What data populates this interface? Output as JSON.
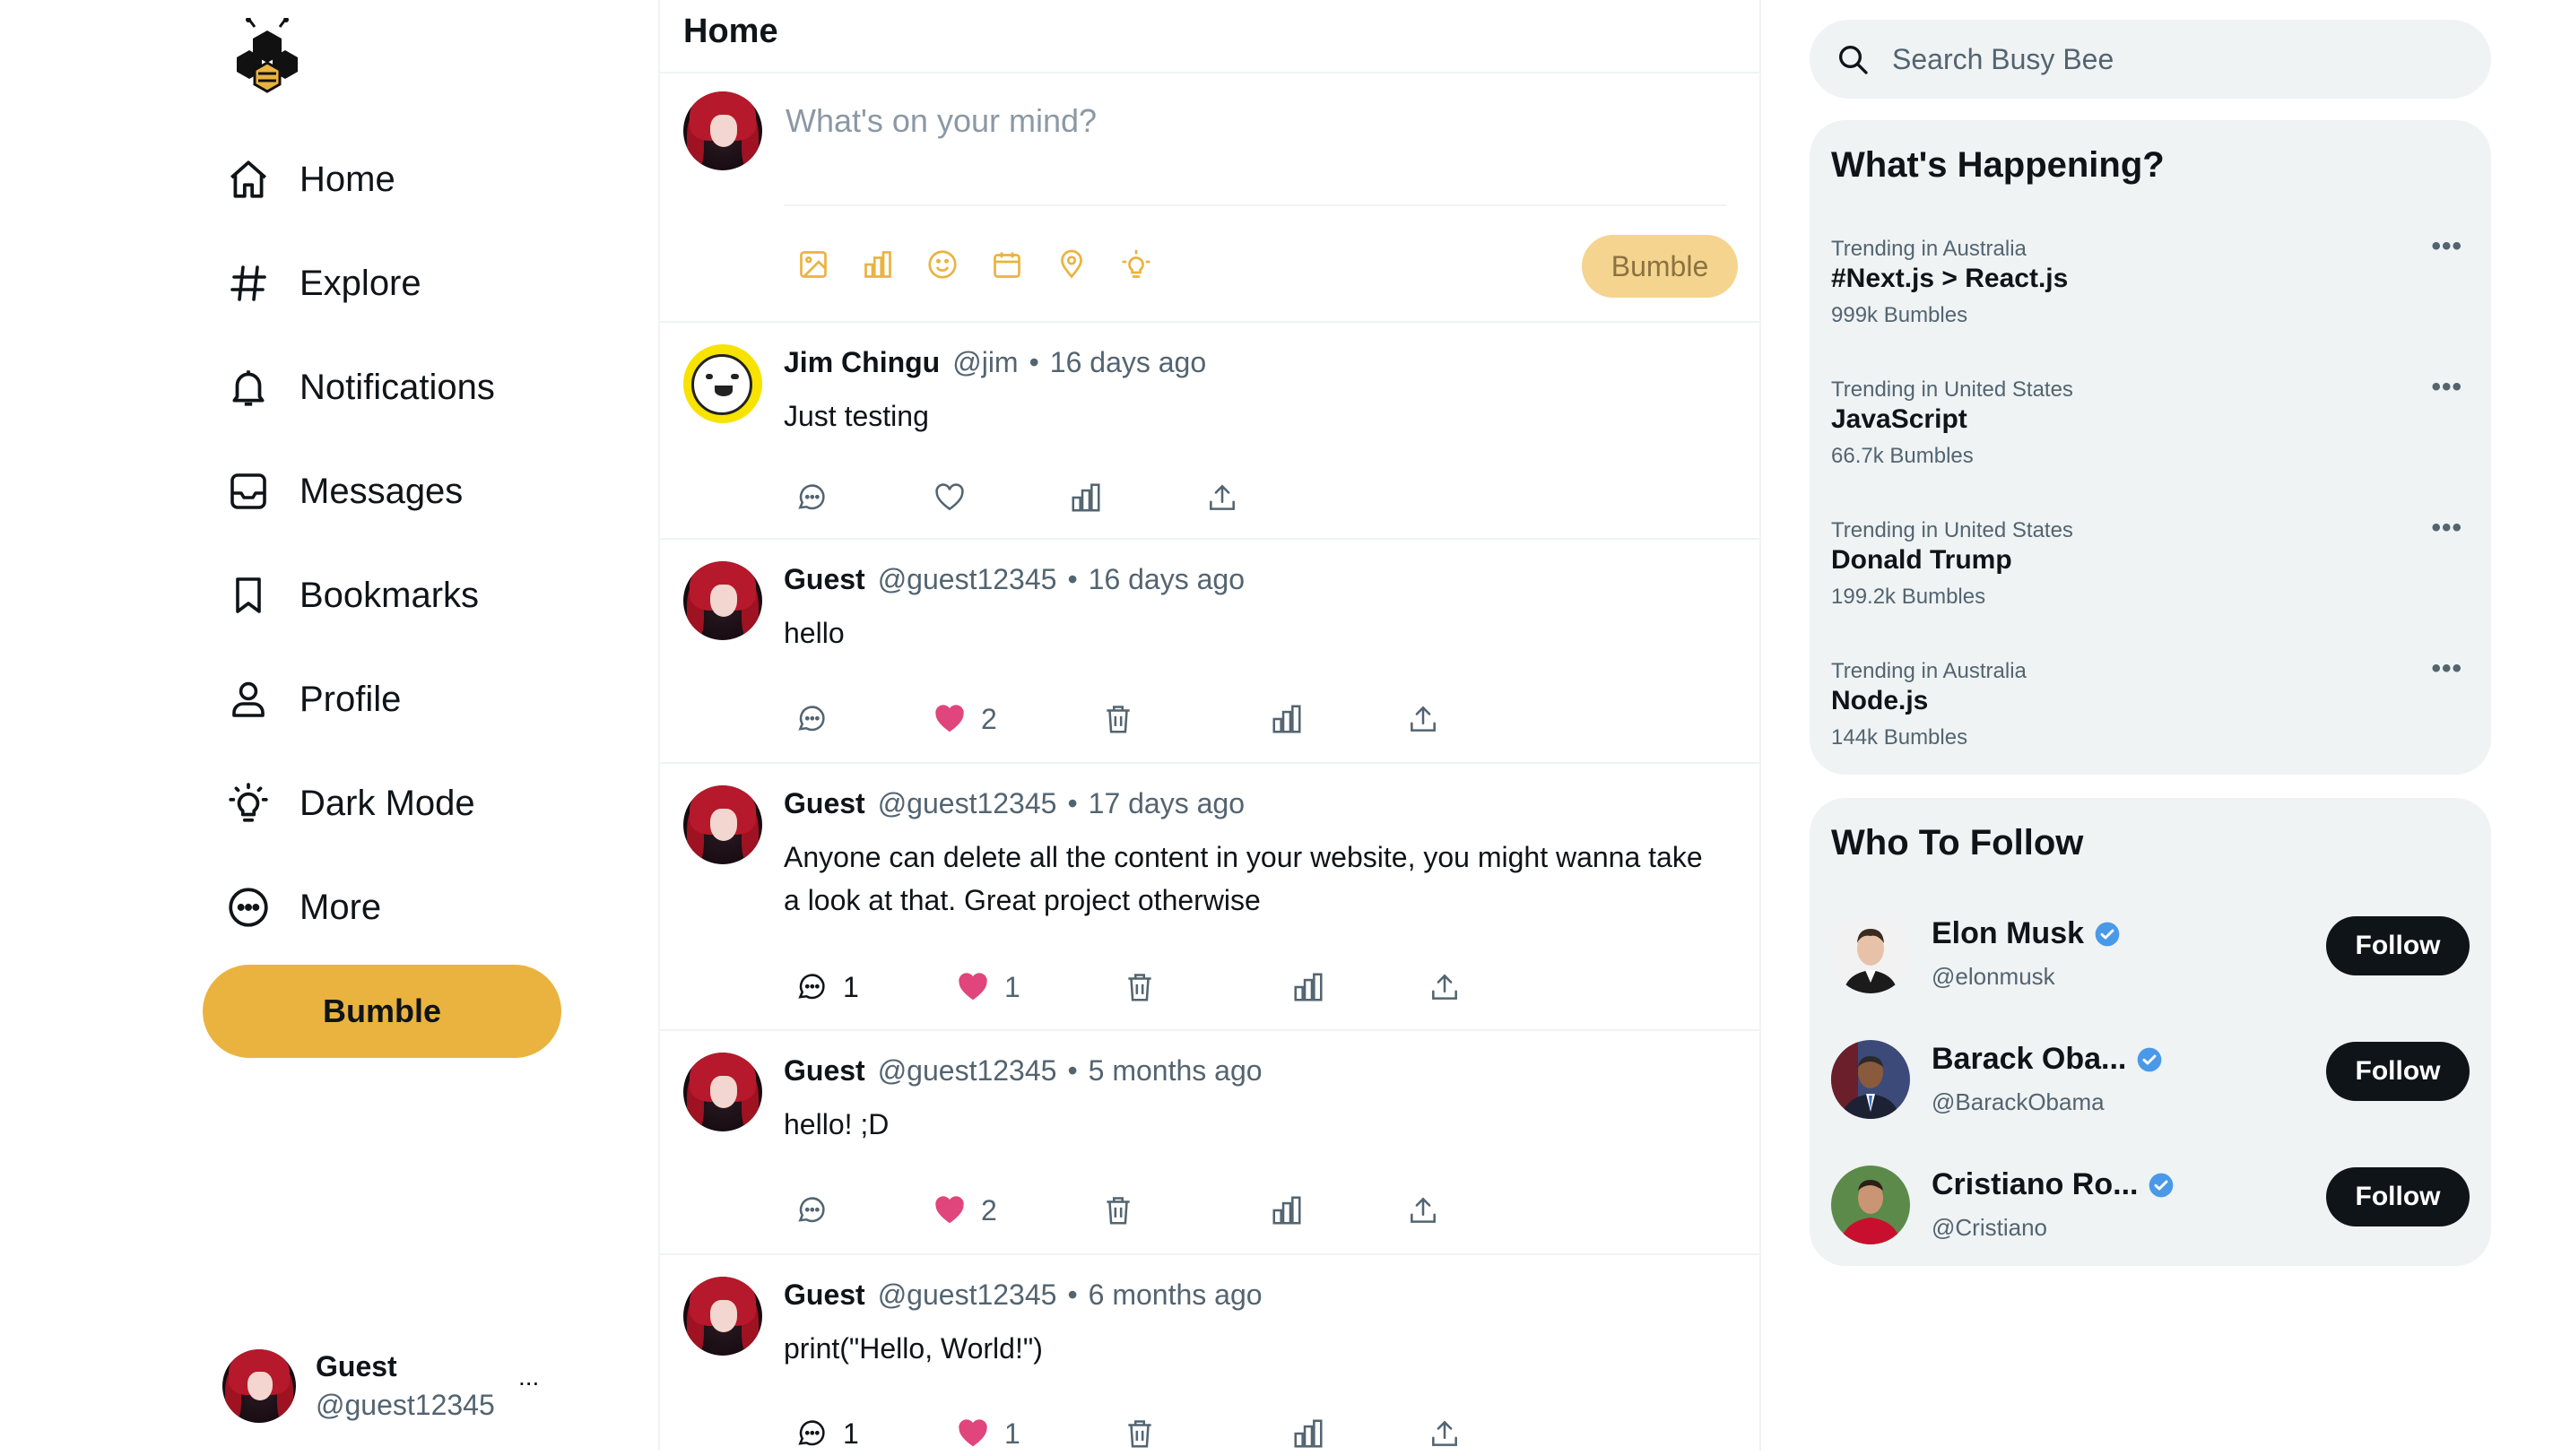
{
  "app": {
    "name": "Busy Bee",
    "accent_color": "#eab33f",
    "logo_icon": "bee-hexagon-logo"
  },
  "nav": {
    "items": [
      {
        "label": "Home",
        "icon": "home-icon"
      },
      {
        "label": "Explore",
        "icon": "hashtag-icon"
      },
      {
        "label": "Notifications",
        "icon": "bell-icon"
      },
      {
        "label": "Messages",
        "icon": "inbox-icon"
      },
      {
        "label": "Bookmarks",
        "icon": "bookmark-icon"
      },
      {
        "label": "Profile",
        "icon": "user-icon"
      },
      {
        "label": "Dark Mode",
        "icon": "lightbulb-icon"
      },
      {
        "label": "More",
        "icon": "more-circle-icon"
      }
    ],
    "bumble_button": "Bumble"
  },
  "account": {
    "name": "Guest",
    "handle": "@guest12345",
    "menu": "..."
  },
  "feed": {
    "title": "Home",
    "composer": {
      "placeholder": "What's on your mind?",
      "tools": [
        "image-icon",
        "poll-icon",
        "emoji-icon",
        "calendar-icon",
        "location-icon",
        "lightbulb-icon"
      ],
      "submit_label": "Bumble"
    },
    "posts": [
      {
        "name": "Jim Chingu",
        "handle": "@jim",
        "sep": "•",
        "time": "16 days ago",
        "text": "Just testing",
        "replies": "",
        "likes": "",
        "liked": false,
        "deletable": false
      },
      {
        "name": "Guest",
        "handle": "@guest12345",
        "sep": "•",
        "time": "16 days ago",
        "text": "hello",
        "replies": "",
        "likes": "2",
        "liked": true,
        "deletable": true
      },
      {
        "name": "Guest",
        "handle": "@guest12345",
        "sep": "•",
        "time": "17 days ago",
        "text": "Anyone can delete all the content in your website, you might wanna take a look at that. Great project otherwise",
        "replies": "1",
        "likes": "1",
        "liked": true,
        "deletable": true
      },
      {
        "name": "Guest",
        "handle": "@guest12345",
        "sep": "•",
        "time": "5 months ago",
        "text": "hello! ;D",
        "replies": "",
        "likes": "2",
        "liked": true,
        "deletable": true
      },
      {
        "name": "Guest",
        "handle": "@guest12345",
        "sep": "•",
        "time": "6 months ago",
        "text": "print(\"Hello, World!\")",
        "replies": "1",
        "likes": "1",
        "liked": true,
        "deletable": true
      }
    ]
  },
  "search": {
    "placeholder": "Search Busy Bee"
  },
  "trending": {
    "title": "What's Happening?",
    "menu": "•••",
    "items": [
      {
        "context": "Trending in Australia",
        "topic": "#Next.js > React.js",
        "count": "999k Bumbles"
      },
      {
        "context": "Trending in United States",
        "topic": "JavaScript",
        "count": "66.7k Bumbles"
      },
      {
        "context": "Trending in United States",
        "topic": "Donald Trump",
        "count": "199.2k Bumbles"
      },
      {
        "context": "Trending in Australia",
        "topic": "Node.js",
        "count": "144k Bumbles"
      }
    ]
  },
  "who_to_follow": {
    "title": "Who To Follow",
    "button_label": "Follow",
    "verified_color": "#4a99e9",
    "users": [
      {
        "name": "Elon Musk",
        "handle": "@elonmusk",
        "verified": true
      },
      {
        "name": "Barack Oba...",
        "handle": "@BarackObama",
        "verified": true
      },
      {
        "name": "Cristiano Ro...",
        "handle": "@Cristiano",
        "verified": true
      }
    ]
  },
  "colors": {
    "text": "#0f1419",
    "muted": "#536471",
    "like": "#e0457b",
    "panel": "#eff3f4",
    "bumble_disabled": "#f5d48f"
  }
}
